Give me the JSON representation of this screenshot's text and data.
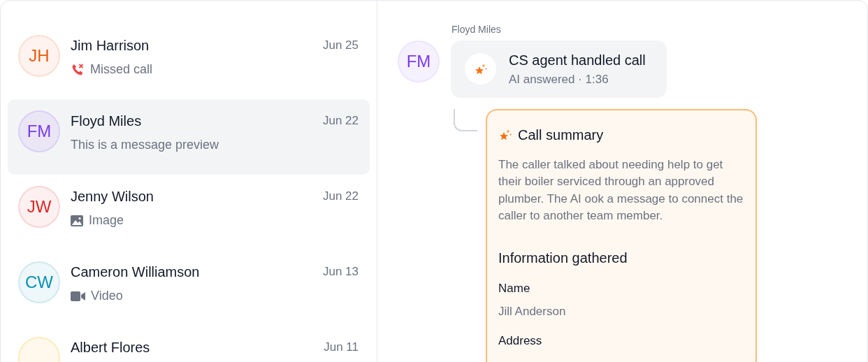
{
  "conversations": [
    {
      "initials": "JH",
      "color": "#ea580c",
      "name": "Jim Harrison",
      "date": "Jun 25",
      "preview": {
        "kind": "missed_call",
        "text": "Missed call"
      },
      "selected": false
    },
    {
      "initials": "FM",
      "color": "#7c3aed",
      "name": "Floyd Miles",
      "date": "Jun 22",
      "preview": {
        "kind": "text",
        "text": "This is a message preview"
      },
      "selected": true
    },
    {
      "initials": "JW",
      "color": "#dc2626",
      "name": "Jenny Wilson",
      "date": "Jun 22",
      "preview": {
        "kind": "image",
        "text": "Image"
      },
      "selected": false
    },
    {
      "initials": "CW",
      "color": "#0891b2",
      "name": "Cameron Williamson",
      "date": "Jun 13",
      "preview": {
        "kind": "video",
        "text": "Video"
      },
      "selected": false
    },
    {
      "name": "Albert Flores",
      "date": "Jun 11",
      "selected": false
    }
  ],
  "thread": {
    "sender": "Floyd Miles",
    "avatar": {
      "initials": "FM",
      "color": "#7c3aed"
    },
    "call": {
      "title": "CS agent handled call",
      "subtitle": "AI answered · 1:36"
    },
    "summary": {
      "title": "Call summary",
      "body": "The caller talked about needing help to get their boiler serviced through an approved plumber. The AI ook a message to connect the caller to another team member.",
      "section": "Information gathered",
      "fields": [
        {
          "label": "Name",
          "value": "Jill Anderson"
        },
        {
          "label": "Address"
        }
      ]
    }
  }
}
